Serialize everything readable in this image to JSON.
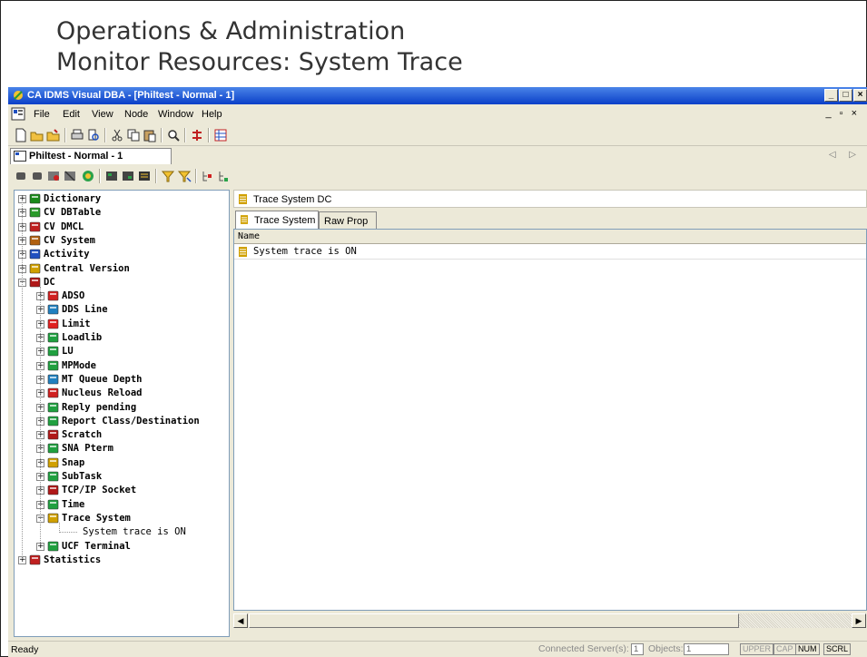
{
  "slide": {
    "title_line1": "Operations & Administration",
    "title_line2": "Monitor Resources: System Trace"
  },
  "window": {
    "title": "CA IDMS Visual DBA - [Philtest - Normal - 1]",
    "buttons": [
      "_",
      "□",
      "×"
    ]
  },
  "menubar": {
    "items": [
      "File",
      "Edit",
      "View",
      "Node",
      "Window",
      "Help"
    ],
    "mdi_controls": "_ ▫ ×"
  },
  "doc_tab": {
    "label": "Philtest - Normal - 1",
    "arrows": "◁ ▷"
  },
  "tree": {
    "items": [
      {
        "label": "Dictionary",
        "level": 0,
        "expander": "+",
        "icon": "dictionary-icon",
        "color": "#1a8a1a"
      },
      {
        "label": "CV DBTable",
        "level": 0,
        "expander": "+",
        "icon": "dbtable-icon",
        "color": "#2a9a2a"
      },
      {
        "label": "CV DMCL",
        "level": 0,
        "expander": "+",
        "icon": "dmcl-icon",
        "color": "#c02020"
      },
      {
        "label": "CV System",
        "level": 0,
        "expander": "+",
        "icon": "system-icon",
        "color": "#b06010"
      },
      {
        "label": "Activity",
        "level": 0,
        "expander": "+",
        "icon": "activity-icon",
        "color": "#2050c0"
      },
      {
        "label": "Central Version",
        "level": 0,
        "expander": "+",
        "icon": "central-version-icon",
        "color": "#d0a000"
      },
      {
        "label": "DC",
        "level": 0,
        "expander": "−",
        "icon": "dc-icon",
        "color": "#b01818"
      },
      {
        "label": "ADSO",
        "level": 1,
        "expander": "+",
        "icon": "adso-icon",
        "color": "#d02020"
      },
      {
        "label": "DDS Line",
        "level": 1,
        "expander": "+",
        "icon": "dds-line-icon",
        "color": "#2080c0"
      },
      {
        "label": "Limit",
        "level": 1,
        "expander": "+",
        "icon": "limit-icon",
        "color": "#e02020"
      },
      {
        "label": "Loadlib",
        "level": 1,
        "expander": "+",
        "icon": "loadlib-icon",
        "color": "#20a040"
      },
      {
        "label": "LU",
        "level": 1,
        "expander": "+",
        "icon": "lu-icon",
        "color": "#20a040"
      },
      {
        "label": "MPMode",
        "level": 1,
        "expander": "+",
        "icon": "mpmode-icon",
        "color": "#20a040"
      },
      {
        "label": "MT Queue Depth",
        "level": 1,
        "expander": "+",
        "icon": "mt-queue-icon",
        "color": "#2080c0"
      },
      {
        "label": "Nucleus Reload",
        "level": 1,
        "expander": "+",
        "icon": "nucleus-icon",
        "color": "#d02020"
      },
      {
        "label": "Reply pending",
        "level": 1,
        "expander": "+",
        "icon": "reply-icon",
        "color": "#20a040"
      },
      {
        "label": "Report Class/Destination",
        "level": 1,
        "expander": "+",
        "icon": "report-icon",
        "color": "#20a040"
      },
      {
        "label": "Scratch",
        "level": 1,
        "expander": "+",
        "icon": "scratch-icon",
        "color": "#b01818"
      },
      {
        "label": "SNA Pterm",
        "level": 1,
        "expander": "+",
        "icon": "sna-icon",
        "color": "#20a040"
      },
      {
        "label": "Snap",
        "level": 1,
        "expander": "+",
        "icon": "snap-icon",
        "color": "#d0a000"
      },
      {
        "label": "SubTask",
        "level": 1,
        "expander": "+",
        "icon": "subtask-icon",
        "color": "#20a040"
      },
      {
        "label": "TCP/IP Socket",
        "level": 1,
        "expander": "+",
        "icon": "tcpip-icon",
        "color": "#b01818"
      },
      {
        "label": "Time",
        "level": 1,
        "expander": "+",
        "icon": "time-icon",
        "color": "#20a040"
      },
      {
        "label": "Trace System",
        "level": 1,
        "expander": "−",
        "icon": "trace-icon",
        "color": "#d0a000"
      },
      {
        "label": "System trace is ON",
        "level": 2,
        "expander": "",
        "icon": "",
        "color": ""
      },
      {
        "label": "UCF Terminal",
        "level": 1,
        "expander": "+",
        "icon": "ucf-icon",
        "color": "#20a040"
      },
      {
        "label": "Statistics",
        "level": 0,
        "expander": "+",
        "icon": "statistics-icon",
        "color": "#c02020"
      }
    ]
  },
  "detail": {
    "title": "Trace System DC",
    "tabs": [
      "Trace System",
      "Raw Prop"
    ],
    "column_header": "Name",
    "rows": [
      "System trace is ON"
    ]
  },
  "statusbar": {
    "ready": "Ready",
    "servers_label": "Connected Server(s):",
    "servers_value": "1",
    "objects_label": "Objects:",
    "objects_value": "1",
    "indicators": [
      {
        "label": "UPPER",
        "on": false
      },
      {
        "label": "CAP",
        "on": false
      },
      {
        "label": "NUM",
        "on": true
      },
      {
        "label": "SCRL",
        "on": true
      }
    ]
  }
}
